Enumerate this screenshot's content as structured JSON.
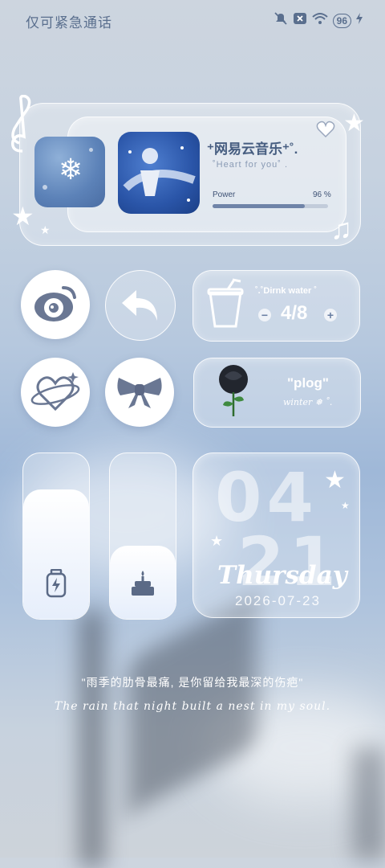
{
  "status_bar": {
    "carrier": "仅可紧急通话",
    "battery": "96"
  },
  "music": {
    "title": "⁺网易云音乐⁺˚.",
    "subtitle": "˚Heart for you˚ .",
    "power_label": "Power",
    "power_value": "96 %",
    "power_fraction": 0.8
  },
  "water": {
    "title": "˚.˚Dirnk water ˚",
    "count": "4/8",
    "minus": "−",
    "plus": "+"
  },
  "plog": {
    "title": "\"plog\"",
    "subtitle": "winter ❅ ˚."
  },
  "sliders": {
    "battery_level": 0.78,
    "cake_level": 0.44
  },
  "date_widget": {
    "month": "04",
    "day": "21",
    "weekday": "Thursday",
    "date": "2026-07-23"
  },
  "quote": {
    "chinese": "\"雨季的肋骨最痛, 是你留给我最深的伤疤\"",
    "english": "The rain that night built a nest in my soul."
  },
  "icons": [
    "music-note-icon",
    "star-icon",
    "heart-icon",
    "weibo-icon",
    "back-arrow-icon",
    "cup-icon",
    "heart-orbit-icon",
    "bow-icon",
    "rose-icon",
    "battery-icon",
    "cake-icon",
    "snowflake-icon"
  ],
  "colors": {
    "accent": "#6f84a8",
    "text_dark": "#465d80"
  }
}
